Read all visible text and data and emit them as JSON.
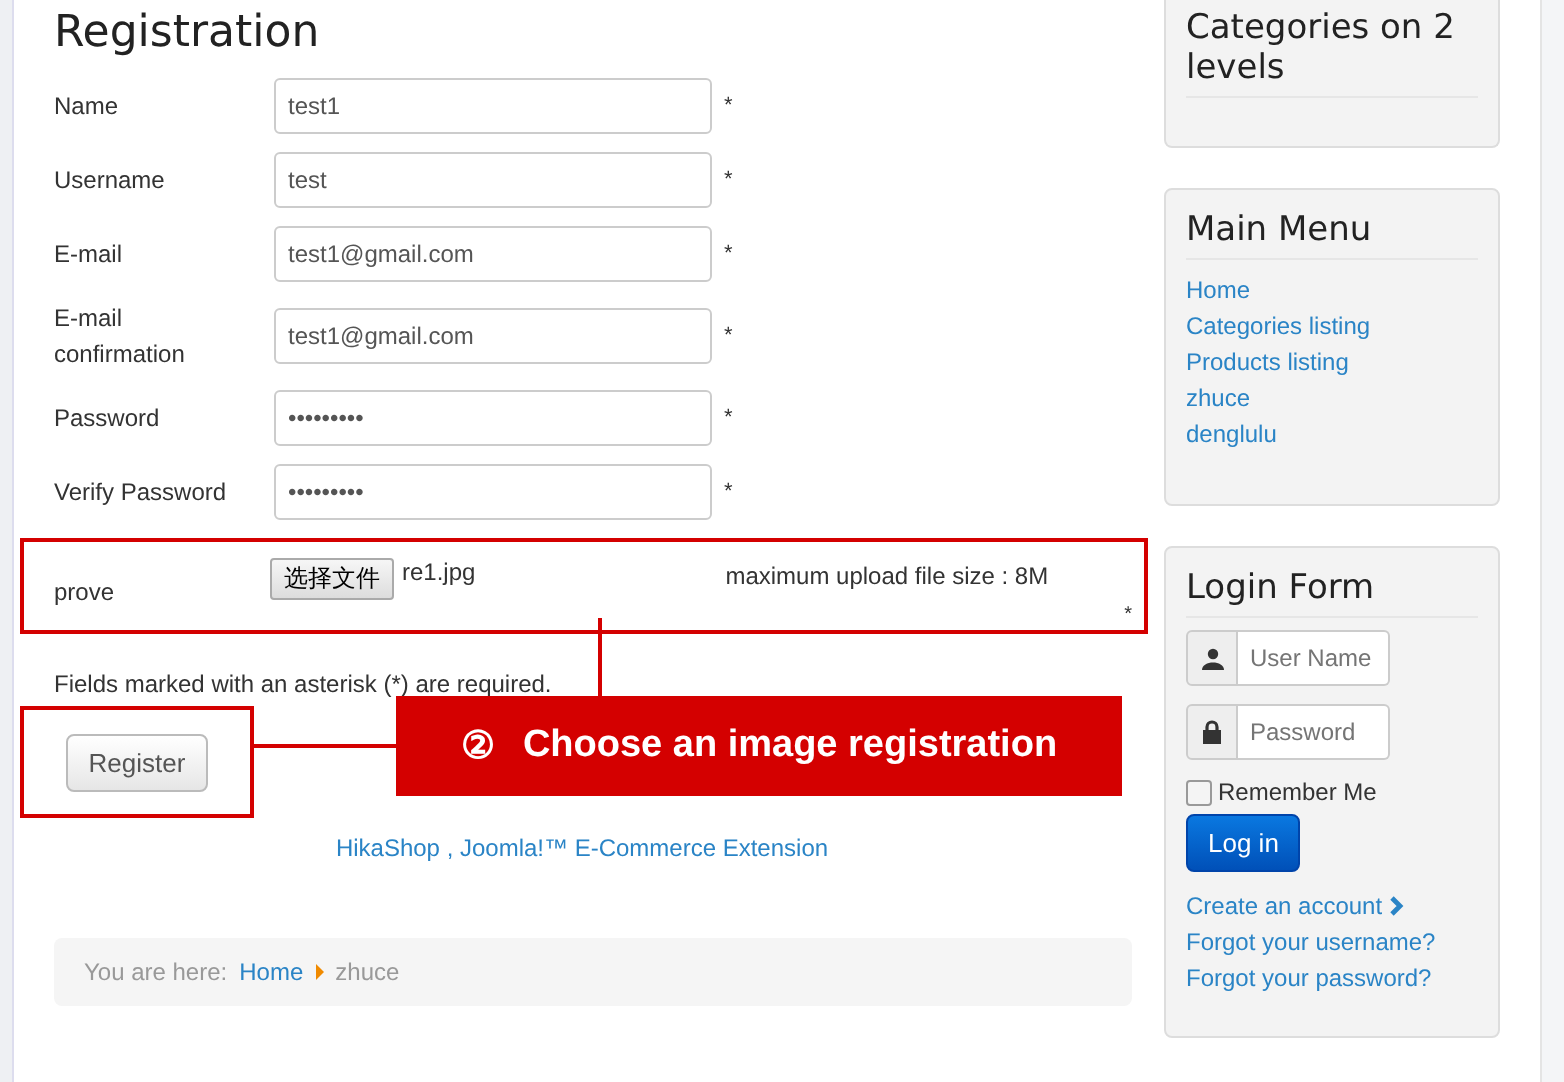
{
  "page_title": "Registration",
  "fields": [
    {
      "label": "Name",
      "value": "test1",
      "required_mark": "*"
    },
    {
      "label": "Username",
      "value": "test",
      "required_mark": "*"
    },
    {
      "label": "E-mail",
      "value": "test1@gmail.com",
      "required_mark": "*"
    },
    {
      "label": "E-mail confirmation",
      "value": "test1@gmail.com",
      "required_mark": "*"
    },
    {
      "label": "Password",
      "value": "•••••••••",
      "required_mark": "*"
    },
    {
      "label": "Verify Password",
      "value": "•••••••••",
      "required_mark": "*"
    }
  ],
  "file_field": {
    "label": "prove",
    "button": "选择文件",
    "file_name": "re1.jpg",
    "note": "maximum upload file size : 8M",
    "required_mark": "*"
  },
  "required_note": "Fields marked with an asterisk (*) are required.",
  "register_button": "Register",
  "callout": {
    "number": "②",
    "text": "Choose an image registration"
  },
  "footer_link": "HikaShop , Joomla!™ E-Commerce Extension",
  "breadcrumb": {
    "label": "You are here:",
    "items": [
      {
        "text": "Home",
        "kind": "link"
      },
      {
        "text": "zhuce",
        "kind": "current"
      }
    ]
  },
  "sidebar": {
    "categories": {
      "title": "Categories on 2 levels"
    },
    "main_menu": {
      "title": "Main Menu",
      "items": [
        "Home",
        "Categories listing",
        "Products listing",
        "zhuce",
        "denglulu"
      ]
    },
    "login": {
      "title": "Login Form",
      "username_placeholder": "User Name",
      "password_placeholder": "Password",
      "remember_label": "Remember Me",
      "remember_checked": false,
      "login_button": "Log in",
      "links": [
        {
          "text": "Create an account",
          "kind": "more"
        },
        {
          "text": "Forgot your username?",
          "kind": "plain"
        },
        {
          "text": "Forgot your password?",
          "kind": "plain"
        }
      ]
    }
  }
}
